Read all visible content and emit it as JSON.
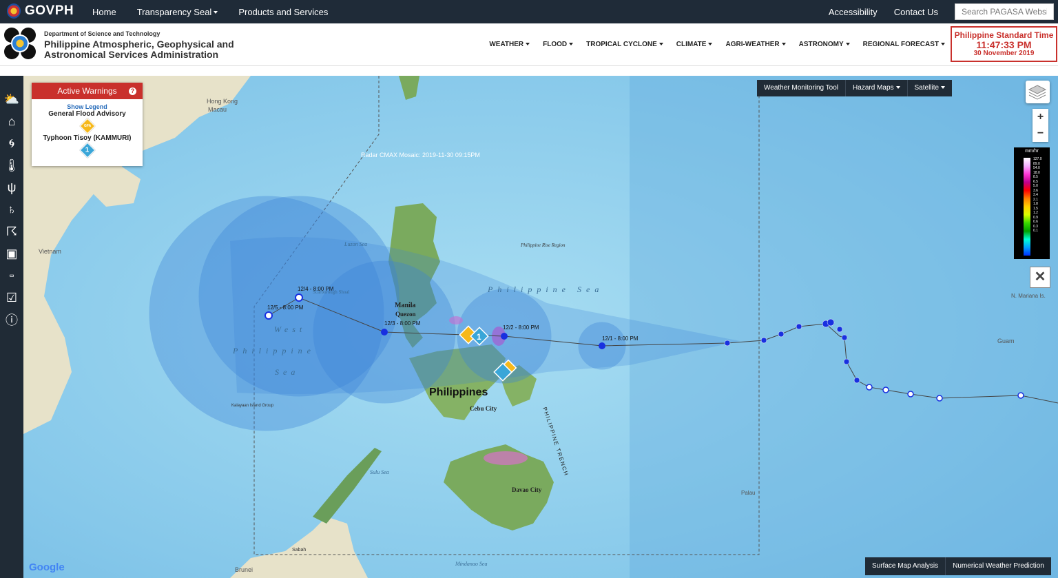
{
  "govbar": {
    "brand": "GOVPH",
    "nav": [
      "Home",
      "Transparency Seal",
      "Products and Services"
    ],
    "accessibility": "Accessibility",
    "contact": "Contact Us",
    "search_placeholder": "Search PAGASA Website"
  },
  "header": {
    "dept": "Department of Science and Technology",
    "agency": "Philippine Atmospheric, Geophysical and Astronomical Services Administration",
    "nav": [
      "WEATHER",
      "FLOOD",
      "TROPICAL CYCLONE",
      "CLIMATE",
      "AGRI-WEATHER",
      "ASTRONOMY",
      "REGIONAL FORECAST"
    ],
    "pst": {
      "title": "Philippine Standard Time",
      "time": "11:47:33 PM",
      "date": "30 November 2019"
    }
  },
  "toolbar_icons": [
    "weather-icon",
    "flood-icon",
    "tropical-cyclone-icon",
    "thermometer-icon",
    "agri-icon",
    "astronomy-icon",
    "thunderstorm-icon",
    "box-icon",
    "vacancy-icon",
    "clipboard-icon",
    "info-icon"
  ],
  "warnings": {
    "title": "Active Warnings",
    "help": "?",
    "show_legend": "Show Legend",
    "items": [
      {
        "label": "General Flood Advisory",
        "badge": "GFA"
      },
      {
        "label": "Typhoon Tisoy (KAMMURI)",
        "badge": "1"
      }
    ]
  },
  "map_buttons": {
    "tool": "Weather Monitoring Tool",
    "hazard": "Hazard Maps",
    "satellite": "Satellite"
  },
  "zoom": {
    "in": "+",
    "out": "−"
  },
  "colorbar": {
    "unit": "mm/hr",
    "labels": [
      "127.0",
      "89.0",
      "54.0",
      "18.0",
      "8.5",
      "6.5",
      "5.0",
      "3.6",
      "3.4",
      "2.1",
      "1.8",
      "1.5",
      "1.2",
      "0.9",
      "0.6",
      "0.3",
      "0.1"
    ]
  },
  "close": "✕",
  "bottom_buttons": {
    "surface": "Surface Map Analysis",
    "nwp": "Numerical Weather Prediction"
  },
  "map_labels": {
    "radar": "Radar CMAX Mosaic: 2019-11-30 09:15PM",
    "hongkong": "Hong Kong",
    "macau": "Macau",
    "vietnam": "Vietnam",
    "luzon_sea": "Luzon Sea",
    "rise": "Philippine Rise Region",
    "manila": "Manila",
    "quezon": "Quezon",
    "philippines": "Philippines",
    "cebu": "Cebu City",
    "davao": "Davao City",
    "sulu": "Sulu Sea",
    "mindanao": "Mindanao Sea",
    "sabah": "Sabah",
    "brunei": "Brunei",
    "palau": "Palau",
    "guam": "Guam",
    "mariana": "N. Mariana Is.",
    "trench": "PHILIPPINE TRENCH",
    "kalayaan": "Kalayaan Island Group",
    "scarborough": "Scarborough Shoal",
    "wps": [
      "West",
      "Philippine",
      "Sea"
    ],
    "ps": "Philippine Sea",
    "google": "Google"
  },
  "forecast_points": [
    {
      "label": "12/1 - 8:00 PM"
    },
    {
      "label": "12/2 - 8:00 PM"
    },
    {
      "label": "12/3 - 8:00 PM"
    },
    {
      "label": "12/4 - 8:00 PM"
    },
    {
      "label": "12/5 - 8:00 PM"
    }
  ],
  "colors": {
    "accent": "#c9302c",
    "dark": "#202b36",
    "sea": "#8fd0ec",
    "cone": "#3b83d8"
  }
}
